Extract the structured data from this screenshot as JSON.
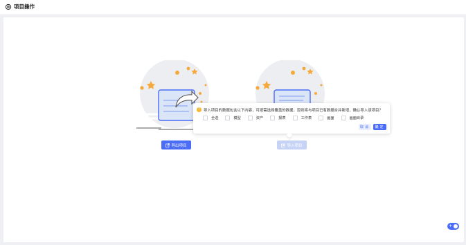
{
  "header": {
    "title": "项目操作",
    "icon": "settings-icon"
  },
  "actions": {
    "export_label": "导出项目",
    "import_label": "导入项目"
  },
  "popover": {
    "message": "导入项目的数据包含以下内容，可按需选择覆盖的数据，否则将与项目已有数据合并新增，确认导入该项目？",
    "options": [
      "全选",
      "模型",
      "资产",
      "报表",
      "工作表",
      "画面",
      "画面目录"
    ],
    "cancel_label": "取消",
    "confirm_label": "确定"
  },
  "colors": {
    "primary": "#4a6cf7",
    "primary_light": "#c7d3f5",
    "warning": "#f7b52c",
    "star": "#f6a93b",
    "background": "#eef0f3"
  }
}
